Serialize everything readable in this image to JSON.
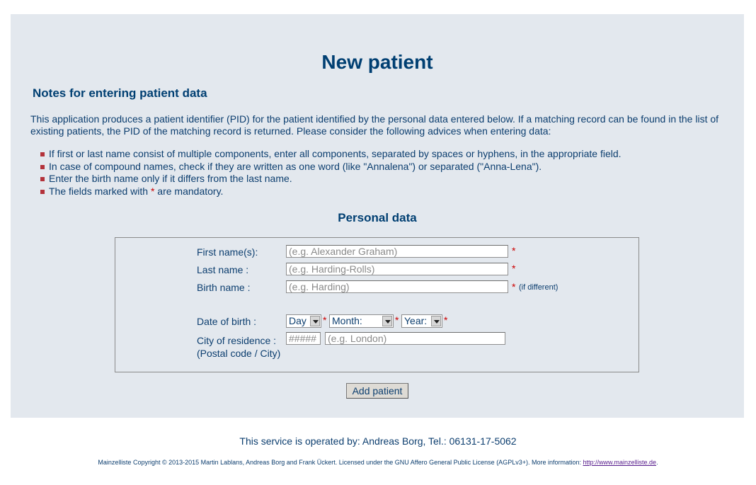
{
  "page": {
    "title": "New patient"
  },
  "notes": {
    "heading": "Notes for entering patient data",
    "intro": "This application produces a patient identifier (PID) for the patient identified by the personal data entered below. If a matching record can be found in the list of existing patients, the PID of the matching record is returned. Please consider the following advices when entering data:",
    "items": [
      "If first or last name consist of multiple components, enter all components, separated by spaces or hyphens, in the appropriate field.",
      "In case of compound names, check if they are written as one word (like \"Annalena\") or separated (\"Anna-Lena\").",
      "Enter the birth name only if it differs from the last name."
    ],
    "mandatory_prefix": "The fields marked with",
    "mandatory_star": "*",
    "mandatory_suffix": "are mandatory.",
    "bullet_color": "#b3323a"
  },
  "form": {
    "heading": "Personal data",
    "required_mark": "*",
    "first_name": {
      "label": "First name(s):",
      "placeholder": "(e.g. Alexander Graham)",
      "value": ""
    },
    "last_name": {
      "label": "Last name :",
      "placeholder": "(e.g. Harding-Rolls)",
      "value": ""
    },
    "birth_name": {
      "label": "Birth name :",
      "placeholder": "(e.g. Harding)",
      "value": "",
      "hint": "(if different)"
    },
    "date_of_birth": {
      "label": "Date of birth :",
      "day": "Day",
      "month": "Month:",
      "year": "Year:"
    },
    "city": {
      "label": "City of residence :",
      "sublabel": "(Postal code / City)",
      "postal_placeholder": "#####",
      "city_placeholder": "(e.g. London)"
    },
    "submit_label": "Add patient"
  },
  "footer": {
    "operator": "This service is operated by: Andreas Borg, Tel.: 06131-17-5062",
    "copyright": "Mainzelliste Copyright © 2013-2015 Martin Lablans, Andreas Borg and Frank Ückert. Licensed under the GNU Affero General Public License (AGPLv3+). More information:",
    "link_text": "http://www.mainzelliste.de",
    "link_suffix": "."
  },
  "colors": {
    "heading": "#003f72",
    "required": "#cc0000",
    "panel_bg": "#e3e8ee"
  }
}
